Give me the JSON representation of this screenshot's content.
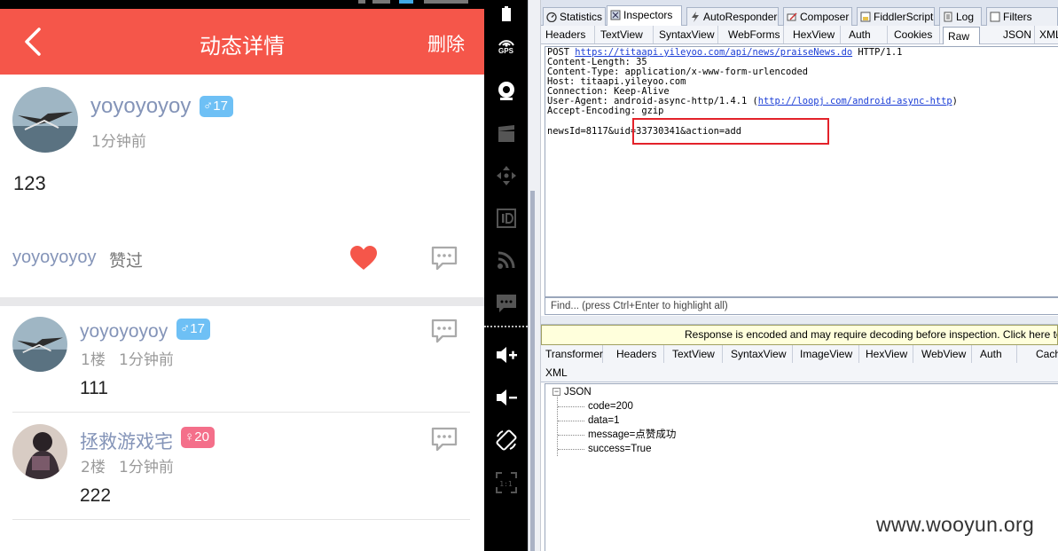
{
  "phone": {
    "header": {
      "title": "动态详情",
      "delete_label": "删除"
    },
    "post": {
      "username": "yoyoyoyoy",
      "badge": "♂17",
      "time": "1分钟前",
      "content": "123",
      "liker": "yoyoyoyoy",
      "liked_text": "赞过"
    },
    "comments": [
      {
        "username": "yoyoyoyoy",
        "badge": "♂17",
        "floor": "1楼",
        "time": "1分钟前",
        "content": "111"
      },
      {
        "username": "拯救游戏宅",
        "badge": "♀20",
        "floor": "2楼",
        "time": "1分钟前",
        "content": "222"
      }
    ],
    "colors": {
      "header": "#f5564a",
      "heart": "#f5564a",
      "male_badge": "#6ec0f5",
      "female_badge": "#f46f8a"
    }
  },
  "emulator": {
    "gps_label": "GPS",
    "scale_label": "1:1",
    "buttons": [
      "gps-icon",
      "camera-icon",
      "clapper-icon",
      "dpad-icon",
      "id-icon",
      "rss-icon",
      "message-icon",
      "volume-up-icon",
      "volume-down-icon",
      "rotate-icon",
      "scale-icon"
    ]
  },
  "fiddler": {
    "top_tabs": [
      "Statistics",
      "Inspectors",
      "AutoResponder",
      "Composer",
      "FiddlerScript",
      "Log",
      "Filters"
    ],
    "active_top_tab": "Inspectors",
    "request_tabs": [
      "Headers",
      "TextView",
      "SyntaxView",
      "WebForms",
      "HexView",
      "Auth",
      "Cookies",
      "Raw",
      "JSON",
      "XML"
    ],
    "active_request_tab": "Raw",
    "raw": {
      "method": "POST",
      "url": "https://titaapi.yileyoo.com/api/news/praiseNews.do",
      "protocol": "HTTP/1.1",
      "content_length": "Content-Length: 35",
      "content_type": "Content-Type: application/x-www-form-urlencoded",
      "host": "Host: titaapi.yileyoo.com",
      "connection": "Connection: Keep-Alive",
      "user_agent_prefix": "User-Agent: android-async-http/1.4.1 (",
      "user_agent_link": "http://loopj.com/android-async-http",
      "user_agent_suffix": ")",
      "accept_encoding": "Accept-Encoding: gzip",
      "body": "newsId=8117&uid=33730341&action=add"
    },
    "find_placeholder": "Find... (press Ctrl+Enter to highlight all)",
    "response_notice": "Response is encoded and may require decoding before inspection. Click here to transform",
    "response_tabs": [
      "Transformer",
      "Headers",
      "TextView",
      "SyntaxView",
      "ImageView",
      "HexView",
      "WebView",
      "Auth",
      "Caching"
    ],
    "response_tab_xml": "XML",
    "json_tree": {
      "root": "JSON",
      "toggle": "−",
      "nodes": [
        "code=200",
        "data=1",
        "message=点赞成功",
        "success=True"
      ]
    },
    "watermark": "www.wooyun.org"
  }
}
